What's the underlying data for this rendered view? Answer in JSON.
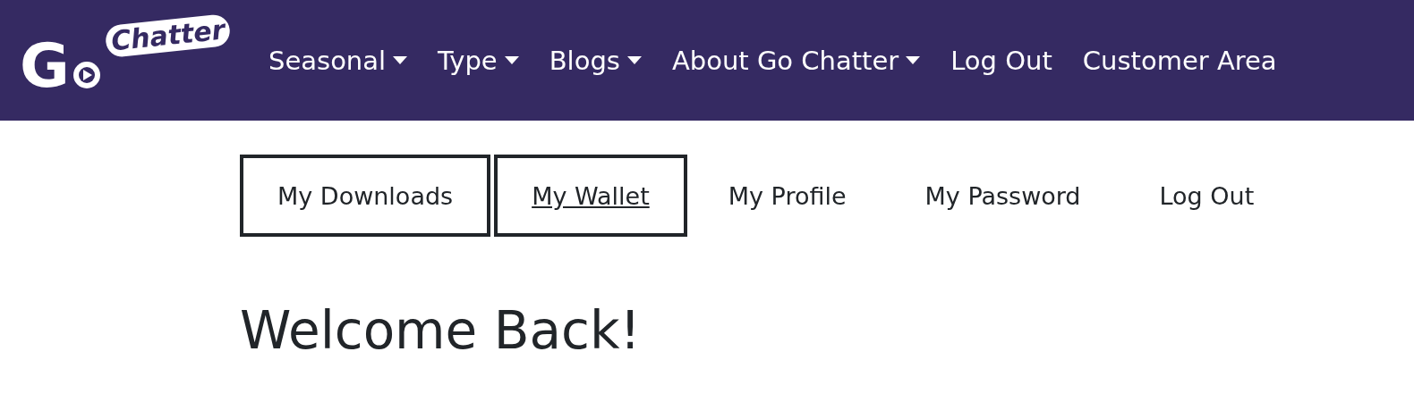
{
  "logo": {
    "first": "G",
    "second": "Chatter"
  },
  "nav": [
    {
      "label": "Seasonal",
      "dropdown": true
    },
    {
      "label": "Type",
      "dropdown": true
    },
    {
      "label": "Blogs",
      "dropdown": true
    },
    {
      "label": "About Go Chatter",
      "dropdown": true
    },
    {
      "label": "Log Out",
      "dropdown": false
    },
    {
      "label": "Customer Area",
      "dropdown": false
    }
  ],
  "tabs": [
    {
      "label": "My Downloads",
      "boxed": true,
      "selected": false
    },
    {
      "label": "My Wallet",
      "boxed": true,
      "selected": true
    },
    {
      "label": "My Profile",
      "boxed": false,
      "selected": false
    },
    {
      "label": "My Password",
      "boxed": false,
      "selected": false
    },
    {
      "label": "Log Out",
      "boxed": false,
      "selected": false
    }
  ],
  "heading": "Welcome Back!"
}
